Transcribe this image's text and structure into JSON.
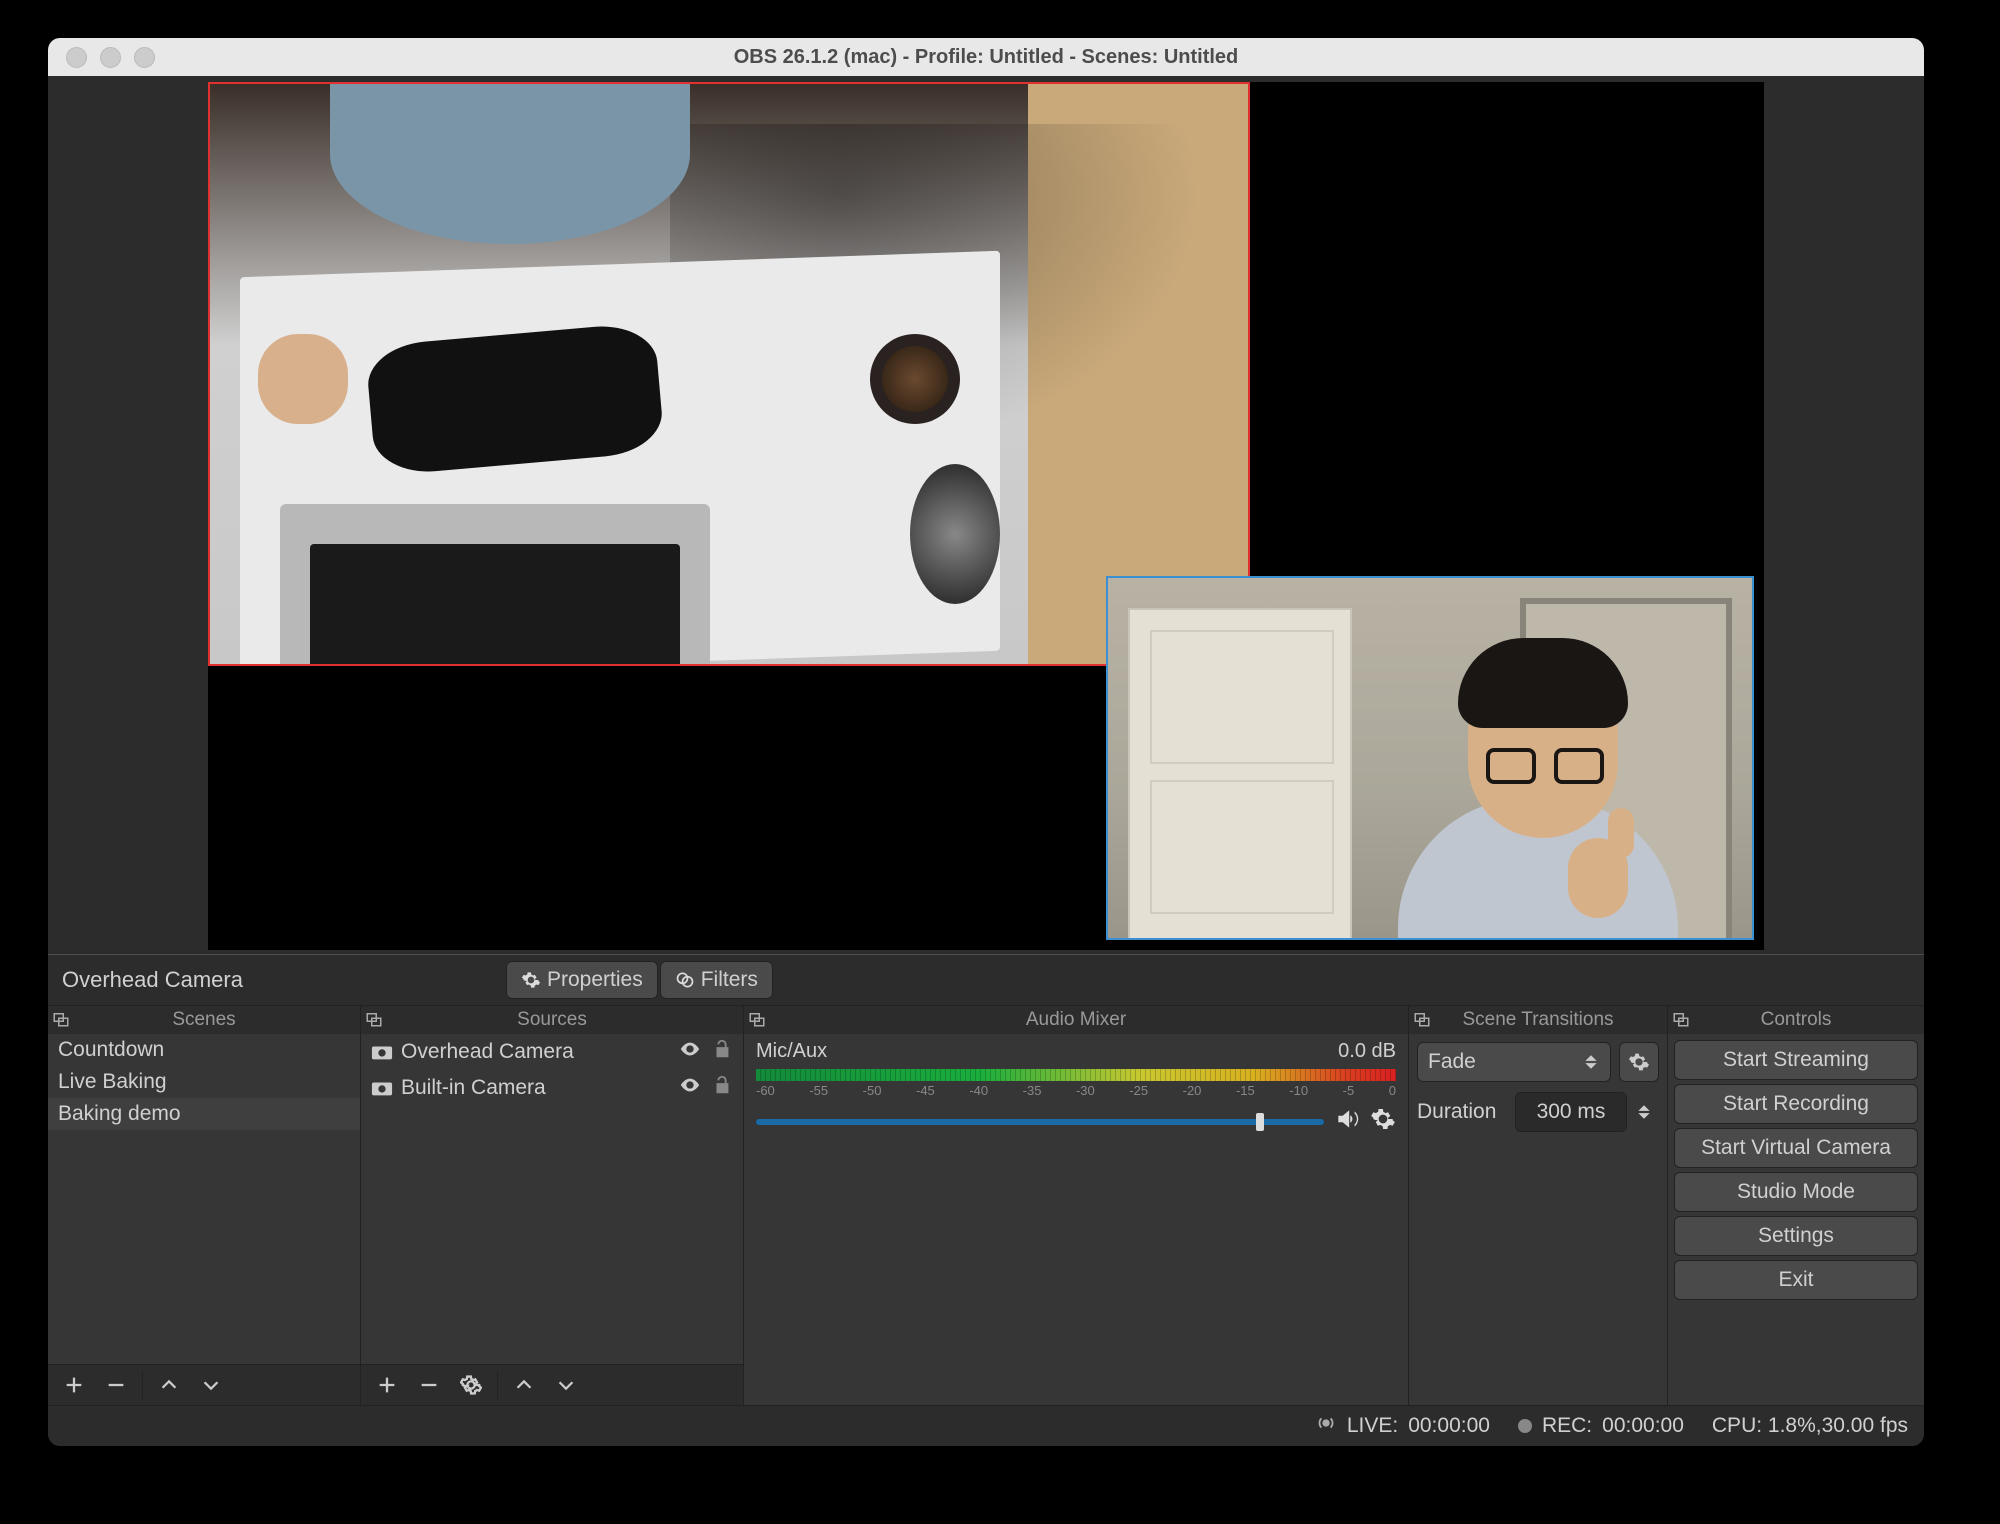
{
  "window": {
    "title": "OBS 26.1.2 (mac) - Profile: Untitled - Scenes: Untitled"
  },
  "context": {
    "selected_source": "Overhead Camera",
    "properties_label": "Properties",
    "filters_label": "Filters"
  },
  "panels": {
    "scenes_title": "Scenes",
    "sources_title": "Sources",
    "mixer_title": "Audio Mixer",
    "transitions_title": "Scene Transitions",
    "controls_title": "Controls"
  },
  "scenes": {
    "items": [
      {
        "name": "Countdown",
        "selected": false
      },
      {
        "name": "Live Baking",
        "selected": false
      },
      {
        "name": "Baking demo",
        "selected": true
      }
    ]
  },
  "sources": {
    "items": [
      {
        "name": "Overhead Camera",
        "visible": true,
        "locked": false
      },
      {
        "name": "Built-in Camera",
        "visible": true,
        "locked": false
      }
    ]
  },
  "mixer": {
    "channel_name": "Mic/Aux",
    "level": "0.0 dB",
    "ticks": [
      "-60",
      "-55",
      "-50",
      "-45",
      "-40",
      "-35",
      "-30",
      "-25",
      "-20",
      "-15",
      "-10",
      "-5",
      "0"
    ]
  },
  "transitions": {
    "selected": "Fade",
    "duration_label": "Duration",
    "duration_value": "300 ms"
  },
  "controls": {
    "buttons": [
      "Start Streaming",
      "Start Recording",
      "Start Virtual Camera",
      "Studio Mode",
      "Settings",
      "Exit"
    ]
  },
  "status": {
    "live_label": "LIVE:",
    "live_time": "00:00:00",
    "rec_label": "REC:",
    "rec_time": "00:00:00",
    "cpu": "CPU: 1.8%,30.00 fps"
  }
}
